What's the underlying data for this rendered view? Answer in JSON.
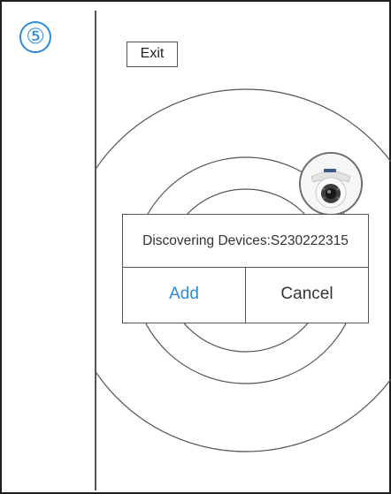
{
  "step": {
    "number": "⑤"
  },
  "header": {
    "exit_label": "Exit"
  },
  "dialog": {
    "message": "Discovering Devices:S230222315",
    "add_label": "Add",
    "cancel_label": "Cancel"
  },
  "colors": {
    "accent": "#2d8bd8",
    "border": "#555555",
    "background": "#ffffff"
  },
  "icons": {
    "device": "dome-camera-icon",
    "scan": "radar-rings"
  }
}
